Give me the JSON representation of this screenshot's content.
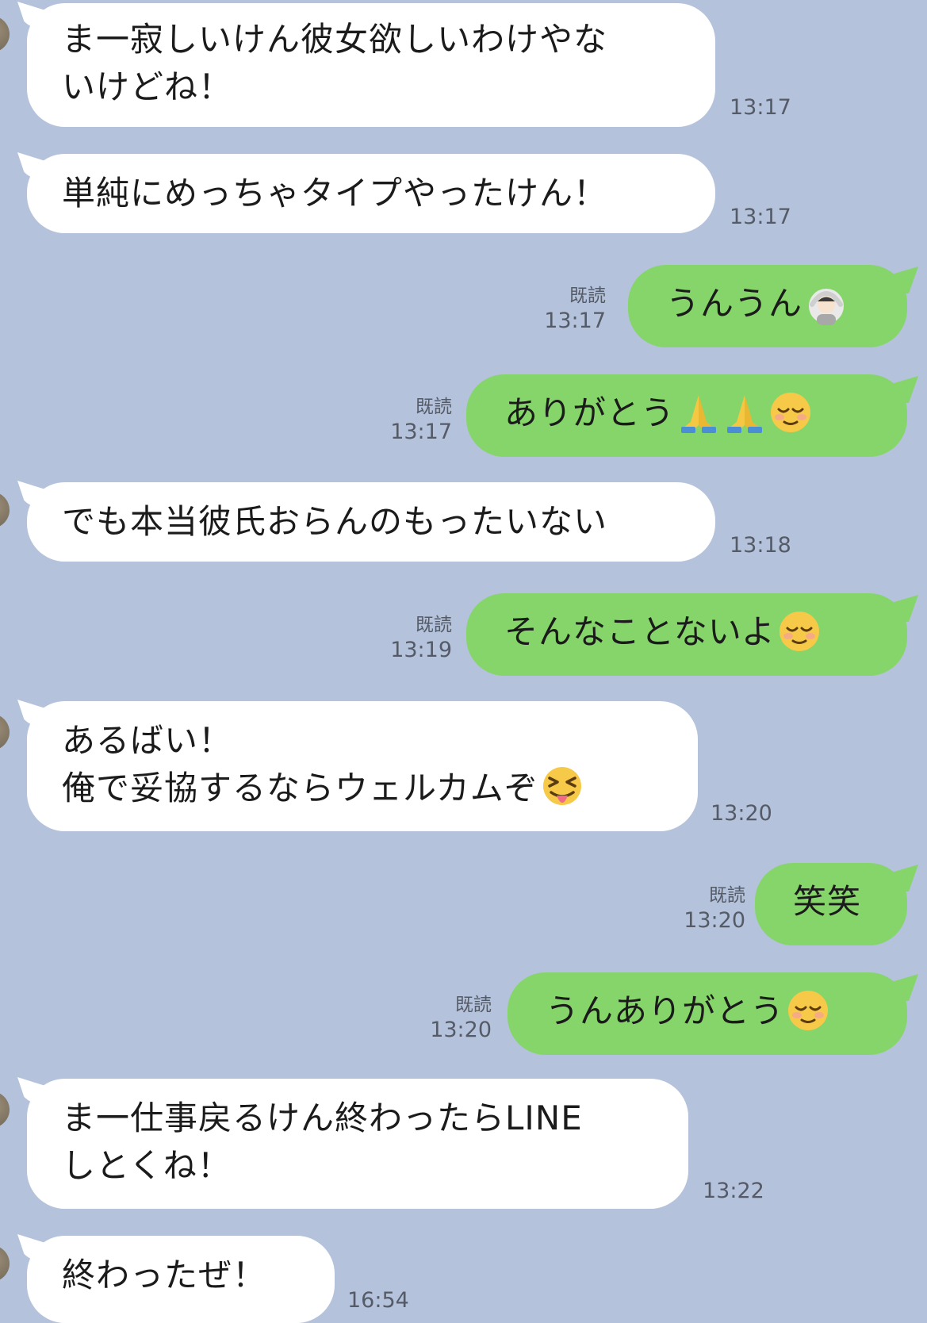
{
  "messages": [
    {
      "side": "in",
      "lines": [
        "ま一寂しいけん彼女欲しいわけやな",
        "いけどね！"
      ],
      "time": "13:17"
    },
    {
      "side": "in",
      "lines": [
        "単純にめっちゃタイプやったけん！"
      ],
      "time": "13:17"
    },
    {
      "side": "out",
      "text": "うんうん",
      "emojis": [
        "person-gesturing-ok-emoji"
      ],
      "read": "既読",
      "time": "13:17"
    },
    {
      "side": "out",
      "text": "ありがとう",
      "emojis": [
        "folded-hands-emoji",
        "folded-hands-emoji",
        "relieved-face-emoji"
      ],
      "read": "既読",
      "time": "13:17"
    },
    {
      "side": "in",
      "lines": [
        "でも本当彼氏おらんのもったいない"
      ],
      "time": "13:18"
    },
    {
      "side": "out",
      "text": "そんなことないよ",
      "emojis": [
        "relieved-face-emoji"
      ],
      "read": "既読",
      "time": "13:19"
    },
    {
      "side": "in",
      "lines": [
        "あるばい！",
        "俺で妥協するならウェルカムぞ"
      ],
      "emojis": [
        "squinting-face-with-tongue-emoji"
      ],
      "time": "13:20"
    },
    {
      "side": "out",
      "text": "笑笑",
      "emojis": [],
      "read": "既読",
      "time": "13:20"
    },
    {
      "side": "out",
      "text": "うんありがとう",
      "emojis": [
        "relieved-face-emoji"
      ],
      "read": "既読",
      "time": "13:20"
    },
    {
      "side": "in",
      "lines": [
        "ま一仕事戻るけん終わったらLINE",
        "しとくね！"
      ],
      "time": "13:22"
    },
    {
      "side": "in",
      "lines": [
        "終わったぜ！"
      ],
      "time": "16:54"
    }
  ],
  "colors": {
    "background": "#b4c2dc",
    "incoming_bubble": "#ffffff",
    "outgoing_bubble": "#86d56a",
    "meta_text": "#555b66"
  }
}
